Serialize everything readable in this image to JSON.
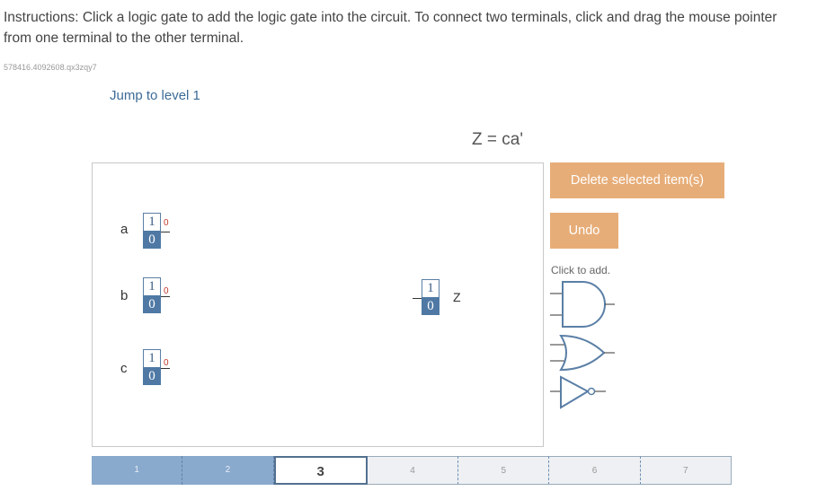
{
  "instructions": "Instructions: Click a logic gate to add the logic gate into the circuit. To connect two terminals, click and drag the mouse pointer from one terminal to the other terminal.",
  "code_id": "578416.4092608.qx3zqy7",
  "jump_link": "Jump to level 1",
  "expression": "Z = ca'",
  "inputs": [
    {
      "label": "a",
      "one": "1",
      "zero": "0",
      "output": "0"
    },
    {
      "label": "b",
      "one": "1",
      "zero": "0",
      "output": "0"
    },
    {
      "label": "c",
      "one": "1",
      "zero": "0",
      "output": "0"
    }
  ],
  "output_node": {
    "label": "Z",
    "one": "1",
    "zero": "0"
  },
  "buttons": {
    "delete": "Delete selected item(s)",
    "undo": "Undo"
  },
  "palette": {
    "hint": "Click to add.",
    "gates": [
      "and-gate-icon",
      "or-gate-icon",
      "not-gate-icon"
    ]
  },
  "levels": {
    "items": [
      "1",
      "2",
      "3",
      "4",
      "5",
      "6",
      "7"
    ],
    "current": "3"
  },
  "colors": {
    "accent_button": "#e7ad78",
    "toggle_blue": "#4f79a4",
    "progress_done": "#89a9cd",
    "output_value_red": "#c0392b"
  }
}
